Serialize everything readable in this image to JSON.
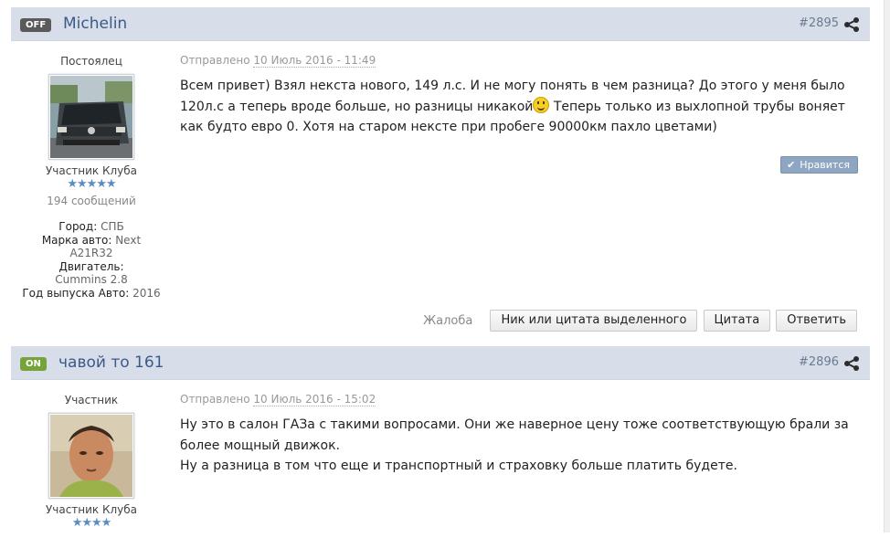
{
  "posts": [
    {
      "status": "OFF",
      "author": "Michelin",
      "post_number": "#2895",
      "member_group": "Постоялец",
      "member_title": "Участник Клуба",
      "stars": "★★★★★",
      "post_count": "194 сообщений",
      "fields": {
        "city_label": "Город:",
        "city": "СПБ",
        "car_label": "Марка авто:",
        "car": "Next A21R32",
        "engine_label": "Двигатель:",
        "engine": "Cummins 2.8",
        "year_label": "Год выпуска Авто:",
        "year": "2016"
      },
      "posted_label": "Отправлено",
      "posted_date": "10 Июль 2016 - 11:49",
      "body_part1": "Всем привет) Взял некста нового, 149 л.с. И не могу понять в чем разница? До этого у меня было 120л.с а теперь вроде больше, но разницы никакой",
      "body_part2": " Теперь только из выхлопной трубы воняет как будто евро 0. Хотя на старом нексте при пробеге 90000км пахло цветами)",
      "like_label": "Нравится",
      "actions": {
        "report": "Жалоба",
        "nick_quote": "Ник или цитата выделенного",
        "quote": "Цитата",
        "reply": "Ответить"
      }
    },
    {
      "status": "ON",
      "author": "чавой то 161",
      "post_number": "#2896",
      "member_group": "Участник",
      "member_title": "Участник Клуба",
      "stars": "★★★★",
      "posted_label": "Отправлено",
      "posted_date": "10 Июль 2016 - 15:02",
      "body_line1": "Ну это в салон ГАЗа с такими вопросами. Они же наверное цену тоже соответствующую брали за более мощный движок.",
      "body_line2": "Ну а разница в том что еще и транспортный  и страховку больше платить будете."
    }
  ],
  "colors": {
    "header_bg": "#d8dee9",
    "author_link": "#3a5a8a",
    "status_off": "#5a5a5a",
    "status_on": "#77a33b",
    "like_button": "#8fa6c2"
  },
  "icons": {
    "share": "share-icon",
    "smiley": "smiley-icon",
    "check": "check-icon"
  }
}
